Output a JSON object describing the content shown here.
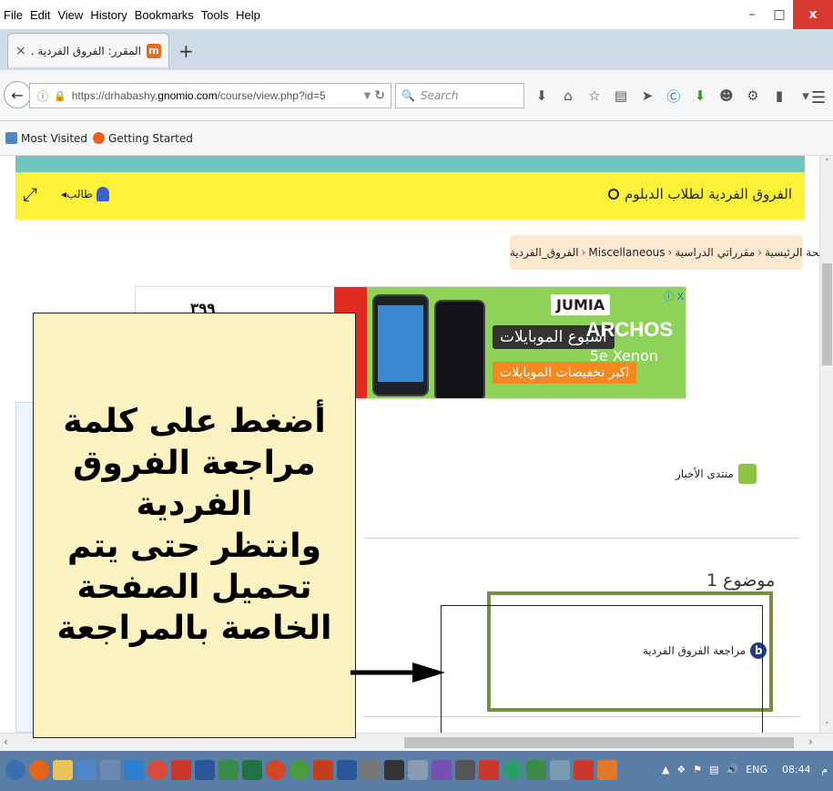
{
  "menubar": {
    "items": [
      "File",
      "Edit",
      "View",
      "History",
      "Bookmarks",
      "Tools",
      "Help"
    ],
    "minimize": "–",
    "maximize": "□",
    "close": "x"
  },
  "tabs": [
    {
      "title": "المقرر: الفروق الفردية ...",
      "close": "×",
      "favicon": "m"
    }
  ],
  "newtab": "+",
  "navbar": {
    "url_prefix": "https://drhabashy.",
    "url_domain": "gnomio.com",
    "url_path": "/course/view.php?id=5",
    "search_placeholder": "Search",
    "icons": [
      "download-icon",
      "home-icon",
      "star-icon",
      "reading-list-icon",
      "send-icon",
      "skype-icon",
      "download-green-icon",
      "chat-icon",
      "extension-icon",
      "battery-icon",
      "overflow-icon"
    ]
  },
  "bookmarks": [
    {
      "label": "Most Visited"
    },
    {
      "label": "Getting Started"
    }
  ],
  "header": {
    "course_title": "الفروق الفردية لطلاب الدبلوم",
    "user_label": "طالب"
  },
  "breadcrumb": [
    "الصفحة الرئيسية",
    "مقرراتي الدراسية",
    "Miscellaneous",
    "الفروق_الفردية"
  ],
  "ad": {
    "brand_store": "JUMIA",
    "brand_phone": "ARCHOS",
    "model": "5e Xenon",
    "headline": "أسبوع الموبايلات",
    "offer": "اكبر تخفيضات الموبايلات",
    "price": "٣٩٩"
  },
  "content": {
    "forum_label": "منتدى الأخبار",
    "topic_title": "موضوع 1",
    "activity_label": "مراجعة الفروق الفردية"
  },
  "callout": {
    "text": "أضغط على كلمة\nمراجعة الفروق\nالفردية\nوانتظر حتى يتم\nتحميل الصفحة\nالخاصة بالمراجعة"
  },
  "taskbar": {
    "language": "ENG",
    "time": "08:44",
    "ampm": "م"
  },
  "colors": {
    "yellow_bar": "#fdf23a",
    "teal_strip": "#6fc6bc",
    "callout_bg": "#fdf2c2",
    "highlight_green": "#77903f",
    "taskbar": "#5a7da6"
  }
}
